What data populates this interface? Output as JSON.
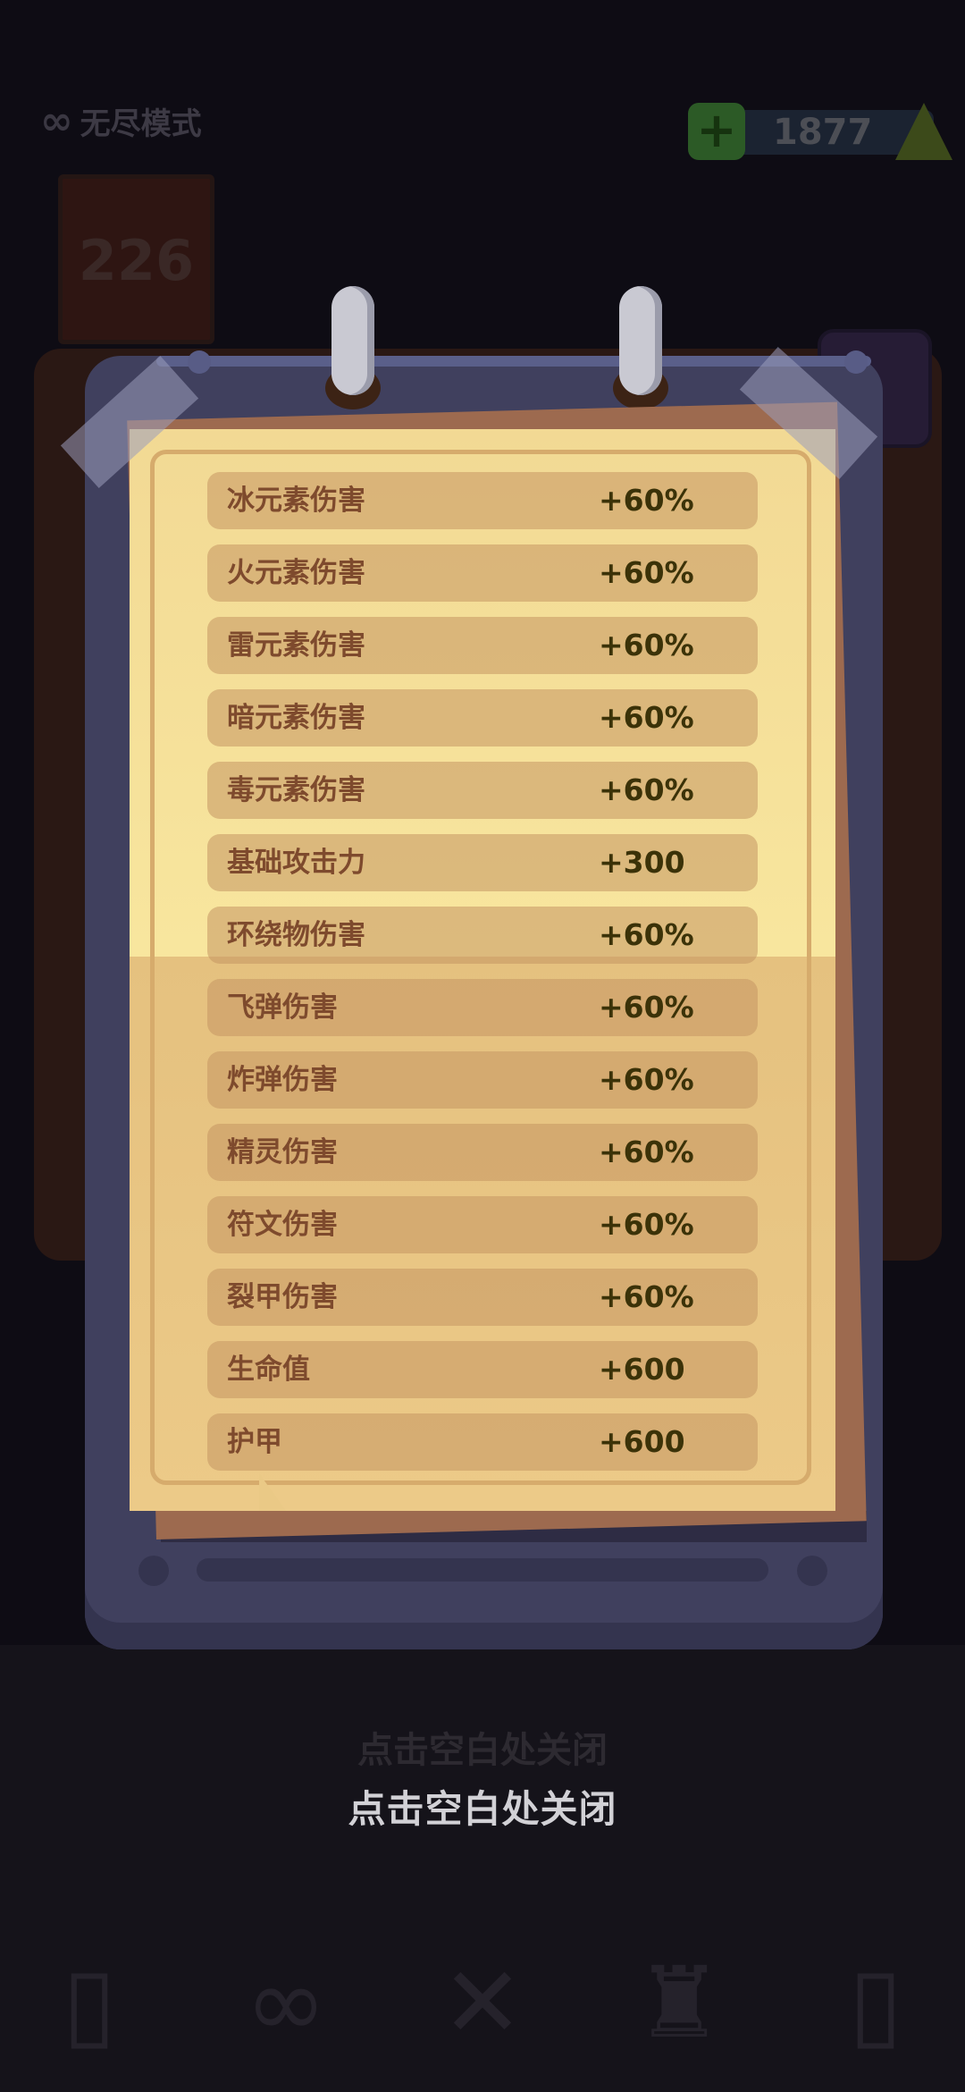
{
  "background": {
    "mode_label": "无尽模式",
    "currency": {
      "amount": "1877"
    },
    "level_banner": {
      "value": "226"
    },
    "close_hint_ghost": "点击空白处关闭"
  },
  "modal": {
    "stats": [
      {
        "name": "冰元素伤害",
        "value": "+60%"
      },
      {
        "name": "火元素伤害",
        "value": "+60%"
      },
      {
        "name": "雷元素伤害",
        "value": "+60%"
      },
      {
        "name": "暗元素伤害",
        "value": "+60%"
      },
      {
        "name": "毒元素伤害",
        "value": "+60%"
      },
      {
        "name": "基础攻击力",
        "value": "+300"
      },
      {
        "name": "环绕物伤害",
        "value": "+60%"
      },
      {
        "name": "飞弹伤害",
        "value": "+60%"
      },
      {
        "name": "炸弹伤害",
        "value": "+60%"
      },
      {
        "name": "精灵伤害",
        "value": "+60%"
      },
      {
        "name": "符文伤害",
        "value": "+60%"
      },
      {
        "name": "裂甲伤害",
        "value": "+60%"
      },
      {
        "name": "生命值",
        "value": "+600"
      },
      {
        "name": "护甲",
        "value": "+600"
      }
    ],
    "close_hint": "点击空白处关闭"
  },
  "icons": {
    "mode": "infinity-icon",
    "currency_add": "plus-icon",
    "currency_gem": "gem-icon",
    "nav": [
      "bin-icon",
      "infinity-icon",
      "swords-icon",
      "trophy-icon",
      "jar-icon"
    ]
  },
  "colors": {
    "paper": "#f3dc98",
    "row_bg": "#c49663",
    "stat_name": "#7e4a2d",
    "stat_value": "#3b3208",
    "clipboard": "#40405e"
  }
}
